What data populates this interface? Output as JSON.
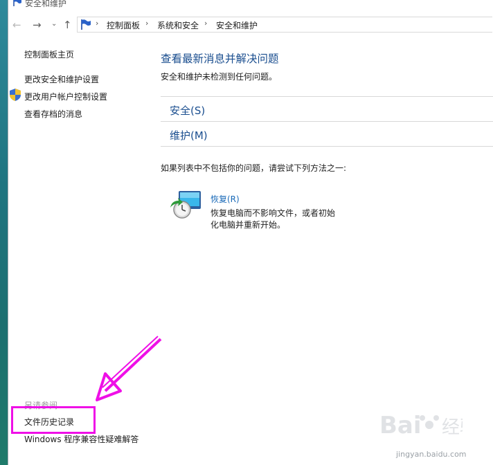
{
  "window": {
    "title": "安全和维护"
  },
  "nav": {
    "back_icon": "arrow-left-icon",
    "forward_icon": "arrow-right-icon",
    "recent_icon": "chevron-down-icon",
    "up_icon": "arrow-up-icon"
  },
  "breadcrumb": [
    "控制面板",
    "系统和安全",
    "安全和维护"
  ],
  "sidebar": {
    "home": "控制面板主页",
    "items": [
      {
        "label": "更改安全和维护设置",
        "icon": null
      },
      {
        "label": "更改用户帐户控制设置",
        "icon": "uac-shield-icon"
      },
      {
        "label": "查看存档的消息",
        "icon": null
      }
    ],
    "see_also_title": "另请参阅",
    "see_also": [
      "文件历史记录",
      "Windows 程序兼容性疑难解答"
    ]
  },
  "main": {
    "heading": "查看最新消息并解决问题",
    "status": "安全和维护未检测到任何问题。",
    "sections": [
      "安全(S)",
      "维护(M)"
    ],
    "suggest_text": "如果列表中不包括你的问题，请尝试下列方法之一:",
    "recovery": {
      "title": "恢复(R)",
      "desc": "恢复电脑而不影响文件，或者初始化电脑并重新开始。",
      "icon": "recovery-icon"
    }
  },
  "annotation": {
    "color": "#ef0fe7"
  },
  "watermark": {
    "text": "jingyan.baidu.com"
  },
  "colors": {
    "link_blue": "#1a4e8f",
    "heading_blue": "#1a4e8f"
  }
}
